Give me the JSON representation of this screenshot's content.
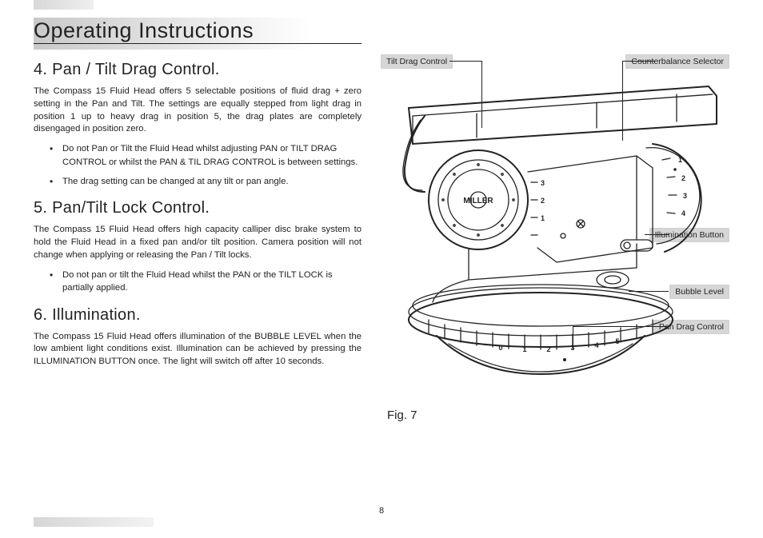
{
  "page_number": "8",
  "title": "Operating Instructions",
  "sections": [
    {
      "heading": "4. Pan / Tilt Drag Control.",
      "para": "The Compass 15 Fluid Head offers 5 selectable positions of fluid drag + zero setting in the Pan and Tilt. The settings are equally stepped from light drag in position 1 up to heavy drag in position 5, the drag plates are completely disengaged in position zero.",
      "bullets": [
        "Do not Pan or Tilt the Fluid Head whilst adjusting PAN or TILT DRAG CONTROL or whilst the PAN & TIL DRAG CONTROL is between settings.",
        "The drag setting can be changed at any tilt or pan angle."
      ]
    },
    {
      "heading": "5. Pan/Tilt Lock Control.",
      "para": "The Compass 15 Fluid Head offers high capacity calliper disc brake system to hold the Fluid Head in a fixed pan and/or tilt position. Camera position will not change when applying or releasing the Pan / Tilt locks.",
      "bullets": [
        "Do not pan or tilt the Fluid Head whilst the PAN or the TILT LOCK is partially applied."
      ]
    },
    {
      "heading": "6. Illumination.",
      "para": "The Compass 15 Fluid Head offers illumination of the BUBBLE LEVEL when the low ambient light conditions exist. Illumination can be achieved by pressing the ILLUMINATION BUTTON once. The light will switch off after 10 seconds.",
      "bullets": []
    }
  ],
  "figure": {
    "caption": "Fig. 7",
    "brand": "MILLER",
    "callouts": {
      "tilt_drag": "Tilt Drag Control",
      "counterbalance": "Counterbalance Selector",
      "illumination": "Illumination Button",
      "bubble": "Bubble Level",
      "pan_drag": "Pan Drag Control"
    },
    "tilt_scale": [
      "1",
      "2",
      "3"
    ],
    "cb_scale": [
      "1",
      "2",
      "3",
      "4"
    ],
    "pan_scale": [
      "0",
      "1",
      "2",
      "3",
      "4",
      "5"
    ]
  }
}
